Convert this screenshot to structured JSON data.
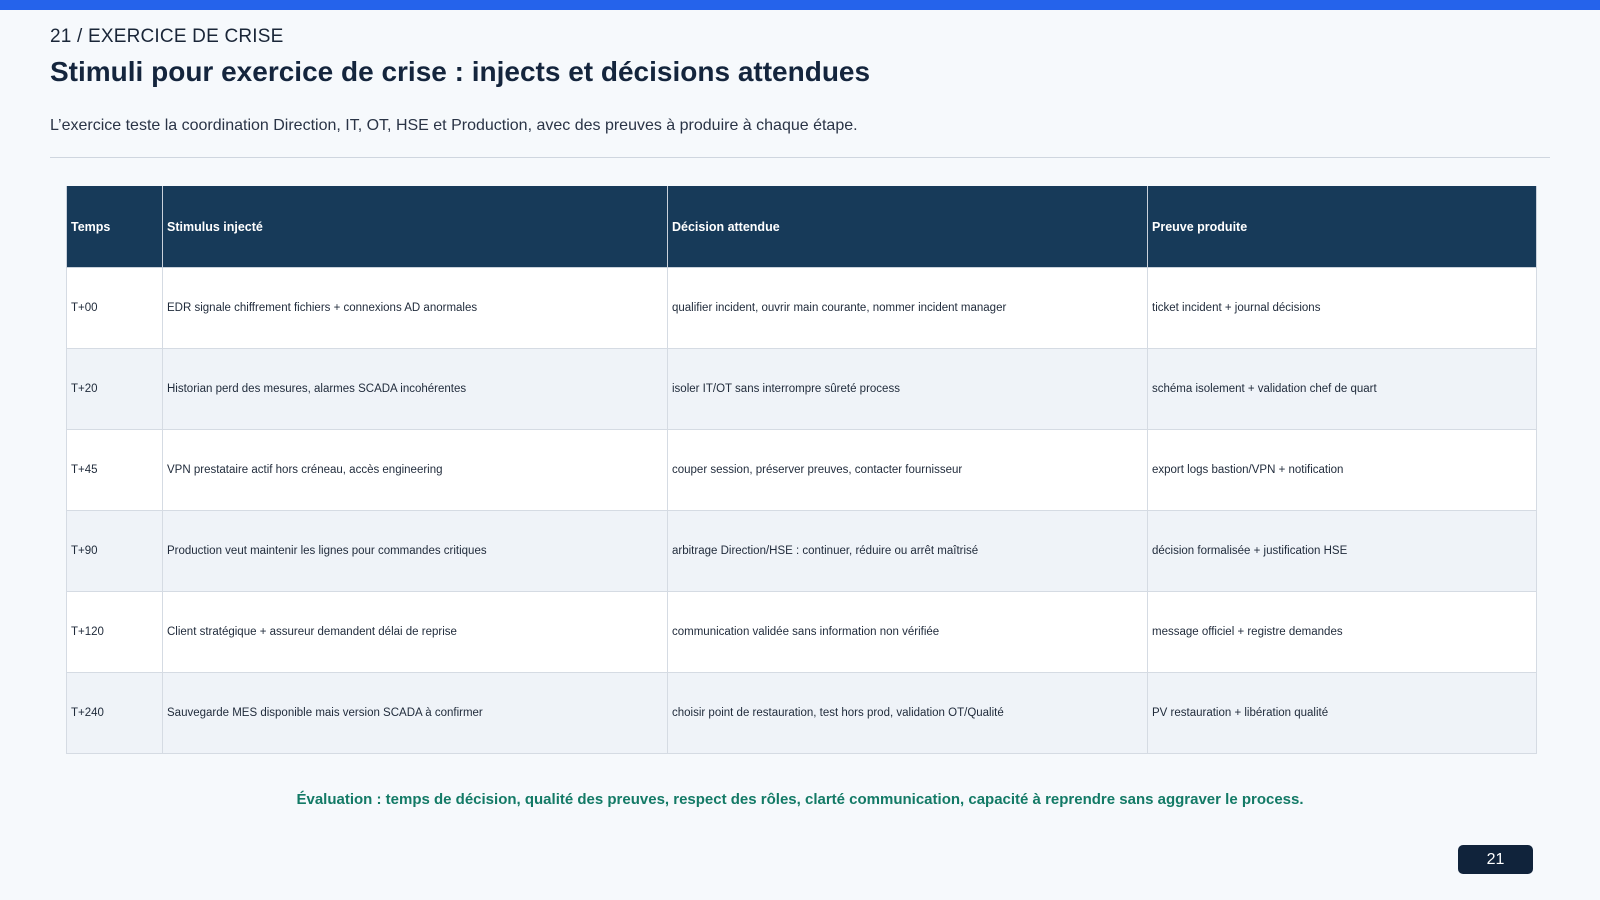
{
  "slide": {
    "kicker": "21 / EXERCICE DE CRISE",
    "title": "Stimuli pour exercice de crise : injects et décisions attendues",
    "subtitle": "L’exercice teste la coordination Direction, IT, OT, HSE et Production, avec des preuves à produire à chaque étape.",
    "page_number": "21",
    "evaluation": "Évaluation : temps de décision, qualité des preuves, respect des rôles, clarté communication, capacité à reprendre sans aggraver le process."
  },
  "colors": {
    "accent_bar": "#2563eb",
    "table_header": "#173a59",
    "evaluation_text": "#137a66",
    "badge": "#10233b"
  },
  "table": {
    "headers": [
      "Temps",
      "Stimulus injecté",
      "Décision attendue",
      "Preuve produite"
    ],
    "rows": [
      [
        "T+00",
        "EDR signale chiffrement fichiers + connexions AD anormales",
        "qualifier incident, ouvrir main courante, nommer incident manager",
        "ticket incident + journal décisions"
      ],
      [
        "T+20",
        "Historian perd des mesures, alarmes SCADA incohérentes",
        "isoler IT/OT sans interrompre sûreté process",
        "schéma isolement + validation chef de quart"
      ],
      [
        "T+45",
        "VPN prestataire actif hors créneau, accès engineering",
        "couper session, préserver preuves, contacter fournisseur",
        "export logs bastion/VPN + notification"
      ],
      [
        "T+90",
        "Production veut maintenir les lignes pour commandes critiques",
        "arbitrage Direction/HSE : continuer, réduire ou arrêt maîtrisé",
        "décision formalisée + justification HSE"
      ],
      [
        "T+120",
        "Client stratégique + assureur demandent délai de reprise",
        "communication validée sans information non vérifiée",
        "message officiel + registre demandes"
      ],
      [
        "T+240",
        "Sauvegarde MES disponible mais version SCADA à confirmer",
        "choisir point de restauration, test hors prod, validation OT/Qualité",
        "PV restauration + libération qualité"
      ]
    ]
  }
}
